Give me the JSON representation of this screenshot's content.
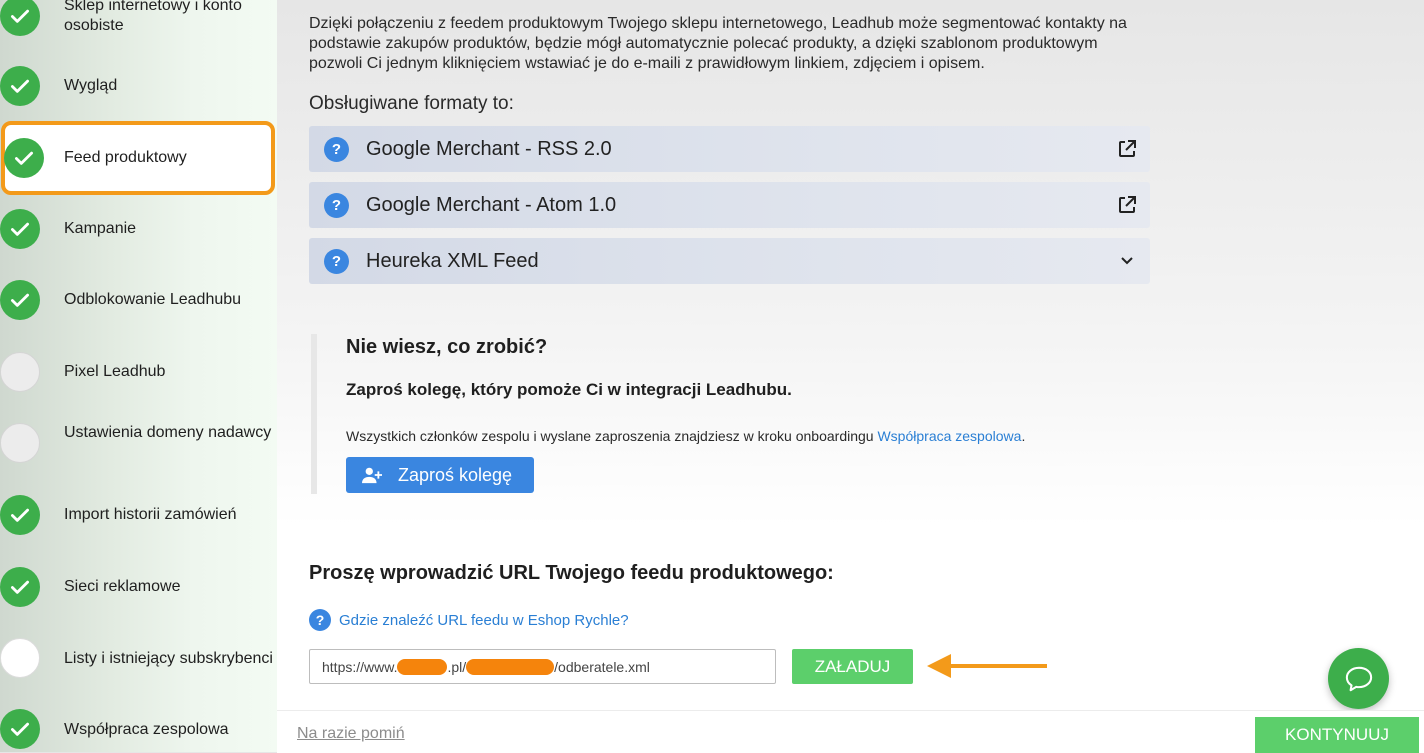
{
  "sidebar": {
    "steps": [
      {
        "label": "Sklep internetowy i konto osobiste",
        "status": "done"
      },
      {
        "label": "Wygląd",
        "status": "done"
      },
      {
        "label": "Feed produktowy",
        "status": "active"
      },
      {
        "label": "Kampanie",
        "status": "done"
      },
      {
        "label": "Odblokowanie Leadhubu",
        "status": "done"
      },
      {
        "label": "Pixel Leadhub",
        "status": "todo"
      },
      {
        "label": "Ustawienia domeny nadawcy",
        "status": "todo"
      },
      {
        "label": "Import historii zamówień",
        "status": "done"
      },
      {
        "label": "Sieci reklamowe",
        "status": "done"
      },
      {
        "label": "Listy i istniejący subskrybenci",
        "status": "todo"
      },
      {
        "label": "Współpraca zespolowa",
        "status": "done"
      }
    ]
  },
  "main": {
    "intro": "Dzięki połączeniu z feedem produktowym Twojego sklepu internetowego, Leadhub może segmentować kontakty na podstawie zakupów produktów, będzie mógł automatycznie polecać produkty, a dzięki szablonom produktowym pozwoli Ci jednym kliknięciem wstawiać je do e-maili z prawidłowym linkiem, zdjęciem i opisem.",
    "formats_title": "Obsługiwane formaty to:",
    "formats": [
      {
        "name": "Google Merchant - RSS 2.0",
        "action_icon": "external-link-icon"
      },
      {
        "name": "Google Merchant - Atom 1.0",
        "action_icon": "external-link-icon"
      },
      {
        "name": "Heureka XML Feed",
        "action_icon": "chevron-down-icon"
      }
    ],
    "help": {
      "title": "Nie wiesz, co zrobić?",
      "subtitle": "Zaproś kolegę, który pomoże Ci w integracji Leadhubu.",
      "text_before": "Wszystkich członków zespolu i wyslane zaproszenia znajdziesz w kroku onboardingu ",
      "link": "Współpraca zespolowa",
      "text_after": ".",
      "invite_button": "Zaproś kolegę"
    },
    "url_section": {
      "title": "Proszę wprowadzić URL Twojego feedu produktowego:",
      "where_link": "Gdzie znaleźć URL feedu w Eshop Rychle?",
      "url_part1": "https://www.",
      "url_part2": ".pl/",
      "url_part3": "/odberatele.xml",
      "load_button": "ZAŁADUJ"
    },
    "footer": {
      "skip": "Na razie pomiń",
      "continue": "KONTYNUUJ"
    }
  },
  "colors": {
    "accent_green": "#3dae4b",
    "button_green": "#5ccf6b",
    "accent_blue": "#3a86e0",
    "highlight_orange": "#f39a1a"
  }
}
